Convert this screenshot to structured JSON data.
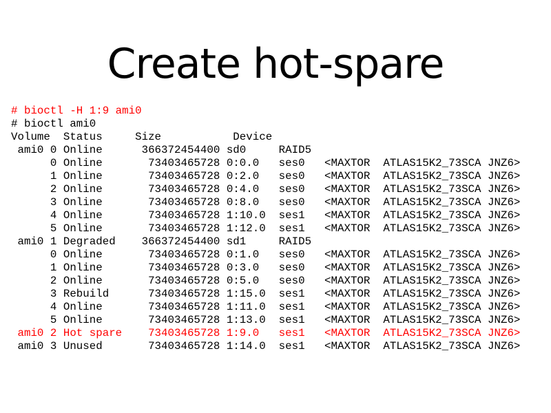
{
  "title": "Create hot-spare",
  "colors": {
    "text": "#000000",
    "highlight": "#ff0000",
    "background": "#ffffff"
  },
  "lines": [
    {
      "text": "# bioctl -H 1:9 ami0",
      "highlight": true
    },
    {
      "text": "# bioctl ami0",
      "highlight": false
    },
    {
      "text": "Volume  Status     Size           Device",
      "highlight": false
    },
    {
      "text": " ami0 0 Online      366372454400 sd0     RAID5",
      "highlight": false
    },
    {
      "text": "      0 Online       73403465728 0:0.0   ses0   <MAXTOR  ATLAS15K2_73SCA JNZ6>",
      "highlight": false
    },
    {
      "text": "      1 Online       73403465728 0:2.0   ses0   <MAXTOR  ATLAS15K2_73SCA JNZ6>",
      "highlight": false
    },
    {
      "text": "      2 Online       73403465728 0:4.0   ses0   <MAXTOR  ATLAS15K2_73SCA JNZ6>",
      "highlight": false
    },
    {
      "text": "      3 Online       73403465728 0:8.0   ses0   <MAXTOR  ATLAS15K2_73SCA JNZ6>",
      "highlight": false
    },
    {
      "text": "      4 Online       73403465728 1:10.0  ses1   <MAXTOR  ATLAS15K2_73SCA JNZ6>",
      "highlight": false
    },
    {
      "text": "      5 Online       73403465728 1:12.0  ses1   <MAXTOR  ATLAS15K2_73SCA JNZ6>",
      "highlight": false
    },
    {
      "text": " ami0 1 Degraded    366372454400 sd1     RAID5",
      "highlight": false
    },
    {
      "text": "      0 Online       73403465728 0:1.0   ses0   <MAXTOR  ATLAS15K2_73SCA JNZ6>",
      "highlight": false
    },
    {
      "text": "      1 Online       73403465728 0:3.0   ses0   <MAXTOR  ATLAS15K2_73SCA JNZ6>",
      "highlight": false
    },
    {
      "text": "      2 Online       73403465728 0:5.0   ses0   <MAXTOR  ATLAS15K2_73SCA JNZ6>",
      "highlight": false
    },
    {
      "text": "      3 Rebuild      73403465728 1:15.0  ses1   <MAXTOR  ATLAS15K2_73SCA JNZ6>",
      "highlight": false
    },
    {
      "text": "      4 Online       73403465728 1:11.0  ses1   <MAXTOR  ATLAS15K2_73SCA JNZ6>",
      "highlight": false
    },
    {
      "text": "      5 Online       73403465728 1:13.0  ses1   <MAXTOR  ATLAS15K2_73SCA JNZ6>",
      "highlight": false
    },
    {
      "text": " ami0 2 Hot spare    73403465728 1:9.0   ses1   <MAXTOR  ATLAS15K2_73SCA JNZ6>",
      "highlight": true
    },
    {
      "text": " ami0 3 Unused       73403465728 1:14.0  ses1   <MAXTOR  ATLAS15K2_73SCA JNZ6>",
      "highlight": false
    }
  ]
}
